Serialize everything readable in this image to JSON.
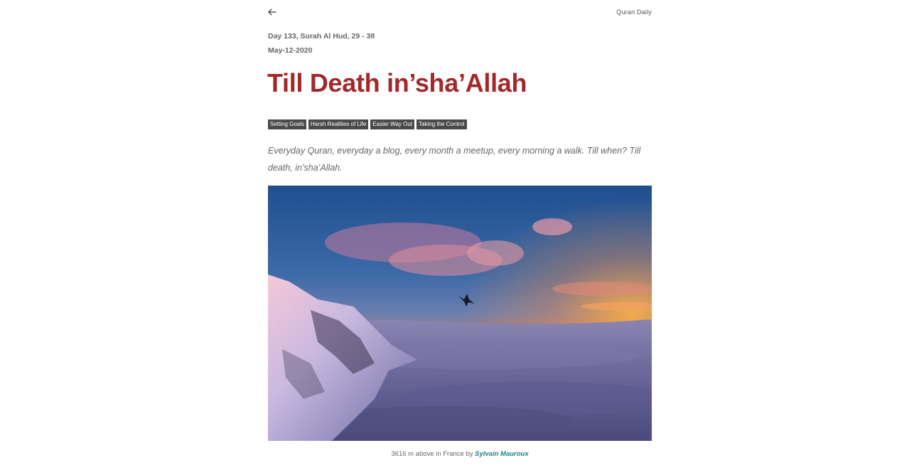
{
  "header": {
    "back_icon": "arrow-left-icon",
    "brand": "Quran Daily"
  },
  "post": {
    "day_info": "Day 133, Surah Al Hud, 29 - 38",
    "date": "May-12-2020",
    "title": "Till Death in’sha’Allah",
    "tags": [
      "Setting Goals",
      "Harsh Realities of Life",
      "Easier Way Out",
      "Taking the Control"
    ],
    "summary": "Everyday Quran, everyday a blog, every month a meetup, every morning a walk. Till when? Till death, in’sha’Allah.",
    "image": {
      "caption_prefix": "3616 m above in France by ",
      "caption_author": "Sylvain Mauroux"
    }
  },
  "colors": {
    "title": "#a3282a",
    "tag_bg": "#4a4a4a",
    "link": "#1f7c8a"
  }
}
